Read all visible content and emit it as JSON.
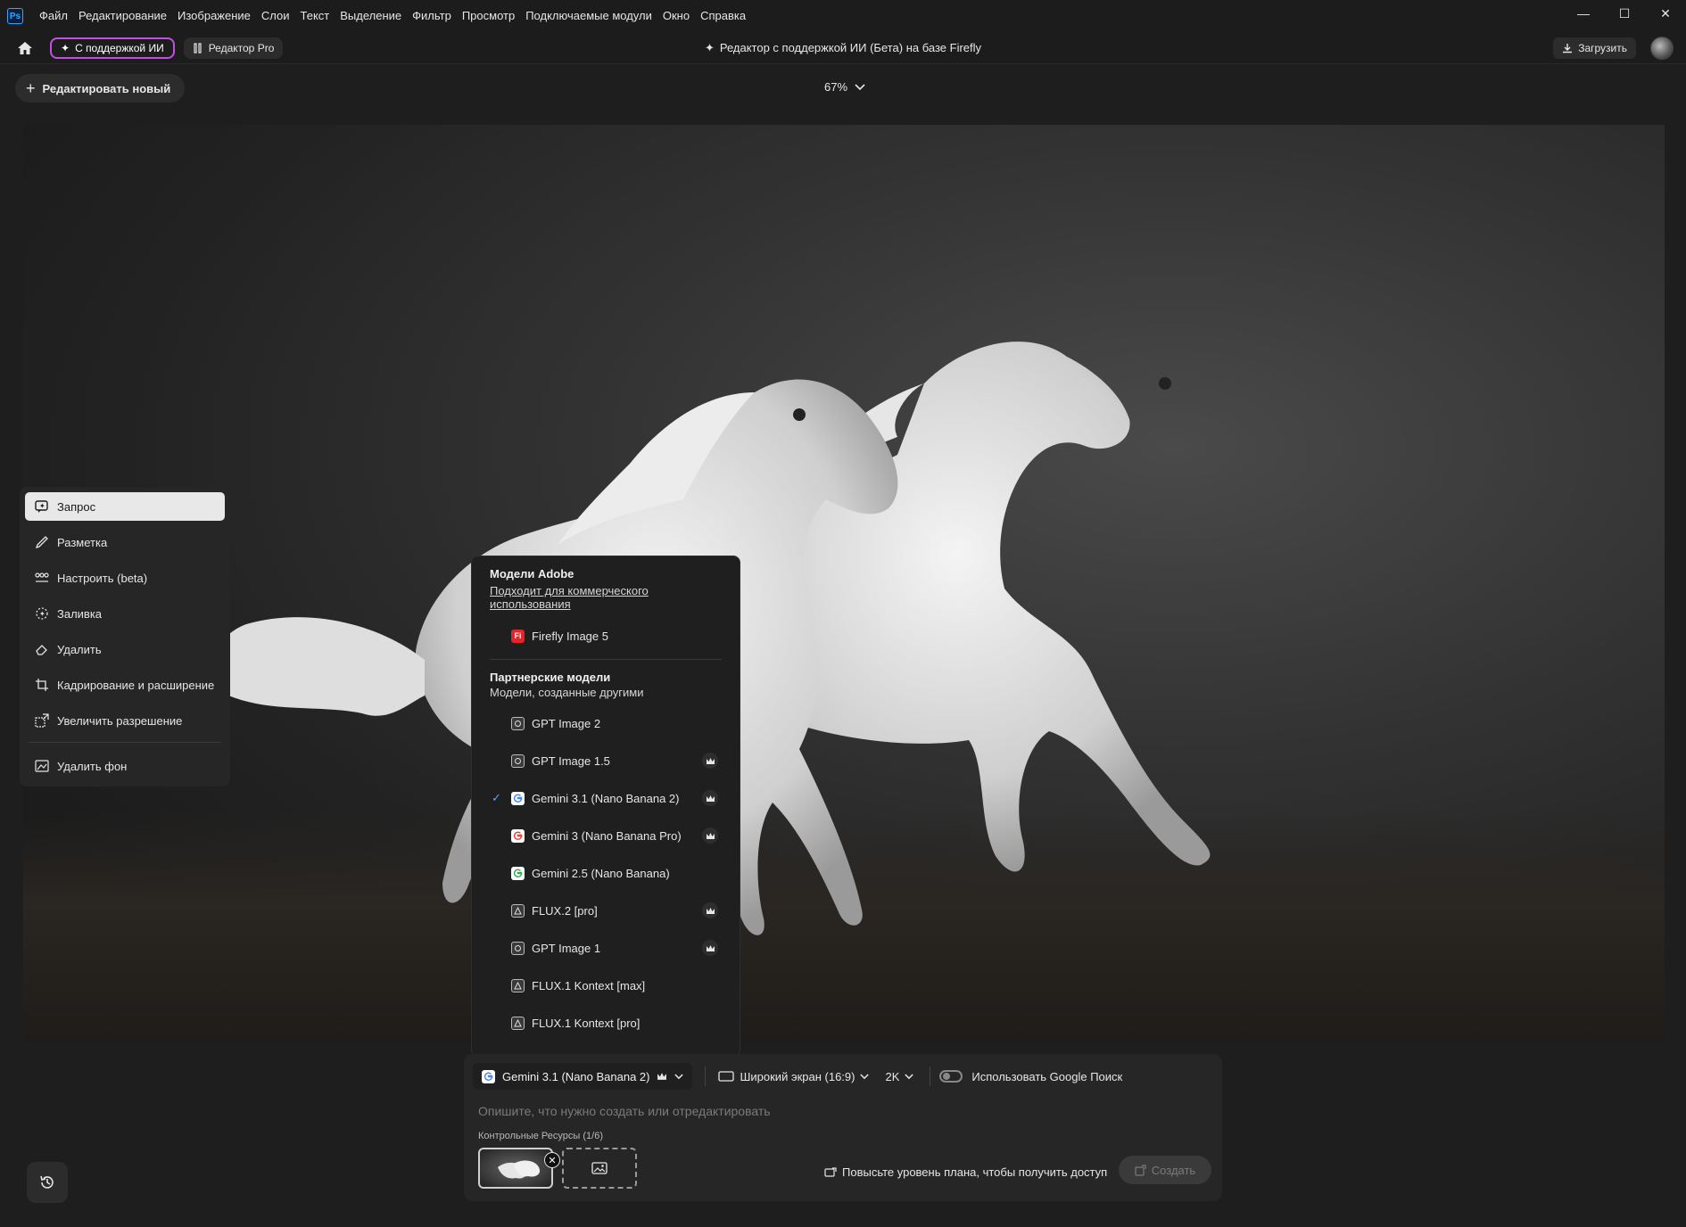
{
  "menu": {
    "logo": "Ps",
    "items": [
      "Файл",
      "Редактирование",
      "Изображение",
      "Слои",
      "Текст",
      "Выделение",
      "Фильтр",
      "Просмотр",
      "Подключаемые модули",
      "Окно",
      "Справка"
    ]
  },
  "window_controls": {
    "minimize": "—",
    "maximize": "☐",
    "close": "✕"
  },
  "header": {
    "ai_mode_label": "С поддержкой ИИ",
    "pro_mode_label": "Редактор Pro",
    "title": "Редактор с поддержкой ИИ (Бета) на базе Firefly",
    "upload_label": "Загрузить"
  },
  "canvas": {
    "new_edit_label": "Редактировать новый",
    "zoom_label": "67%"
  },
  "tools": [
    {
      "label": "Запрос",
      "icon": "prompt-icon",
      "active": true
    },
    {
      "label": "Разметка",
      "icon": "markup-icon",
      "active": false
    },
    {
      "label": "Настроить (beta)",
      "icon": "adjust-icon",
      "active": false
    },
    {
      "label": "Заливка",
      "icon": "fill-icon",
      "active": false
    },
    {
      "label": "Удалить",
      "icon": "eraser-icon",
      "active": false
    },
    {
      "label": "Кадрирование и расширение",
      "icon": "crop-icon",
      "active": false
    },
    {
      "label": "Увеличить разрешение",
      "icon": "upscale-icon",
      "active": false
    },
    {
      "label": "Удалить фон",
      "icon": "remove-background-icon",
      "active": false
    }
  ],
  "model_menu": {
    "adobe_heading": "Модели Adobe",
    "adobe_sub_line1": "Подходит для коммерческого",
    "adobe_sub_line2": "использования",
    "adobe_models": [
      {
        "label": "Firefly Image 5",
        "icon": "firefly-icon",
        "badge": "Fi"
      }
    ],
    "partner_heading": "Партнерские модели",
    "partner_sub": "Модели, созданные другими",
    "partner_models": [
      {
        "label": "GPT Image 2",
        "icon": "openai-icon",
        "premium": false,
        "selected": false
      },
      {
        "label": "GPT Image 1.5",
        "icon": "openai-icon",
        "premium": true,
        "selected": false
      },
      {
        "label": "Gemini 3.1 (Nano Banana 2)",
        "icon": "google-icon",
        "premium": true,
        "selected": true
      },
      {
        "label": "Gemini 3 (Nano Banana Pro)",
        "icon": "google-icon",
        "premium": true,
        "selected": false
      },
      {
        "label": "Gemini 2.5 (Nano Banana)",
        "icon": "google-icon",
        "premium": false,
        "selected": false
      },
      {
        "label": "FLUX.2 [pro]",
        "icon": "flux-icon",
        "premium": true,
        "selected": false
      },
      {
        "label": "GPT Image 1",
        "icon": "openai-icon",
        "premium": true,
        "selected": false
      },
      {
        "label": "FLUX.1 Kontext [max]",
        "icon": "flux-icon",
        "premium": false,
        "selected": false
      },
      {
        "label": "FLUX.1 Kontext [pro]",
        "icon": "flux-icon",
        "premium": false,
        "selected": false
      }
    ]
  },
  "prompt_panel": {
    "selected_model": "Gemini 3.1 (Nano Banana 2)",
    "aspect_label": "Широкий экран (16:9)",
    "resolution_label": "2K",
    "google_search_label": "Использовать Google Поиск",
    "google_search_on": false,
    "placeholder": "Опишите, что нужно создать или отредактировать",
    "resources_label": "Контрольные Ресурсы (1/6)",
    "upgrade_label": "Повысьте уровень плана, чтобы получить доступ",
    "create_label": "Создать"
  },
  "colors": {
    "accent_ai": "#c34fe0",
    "check": "#5aa0ff",
    "firefly_badge": "#e3242b",
    "background": "#1e1e1e"
  }
}
